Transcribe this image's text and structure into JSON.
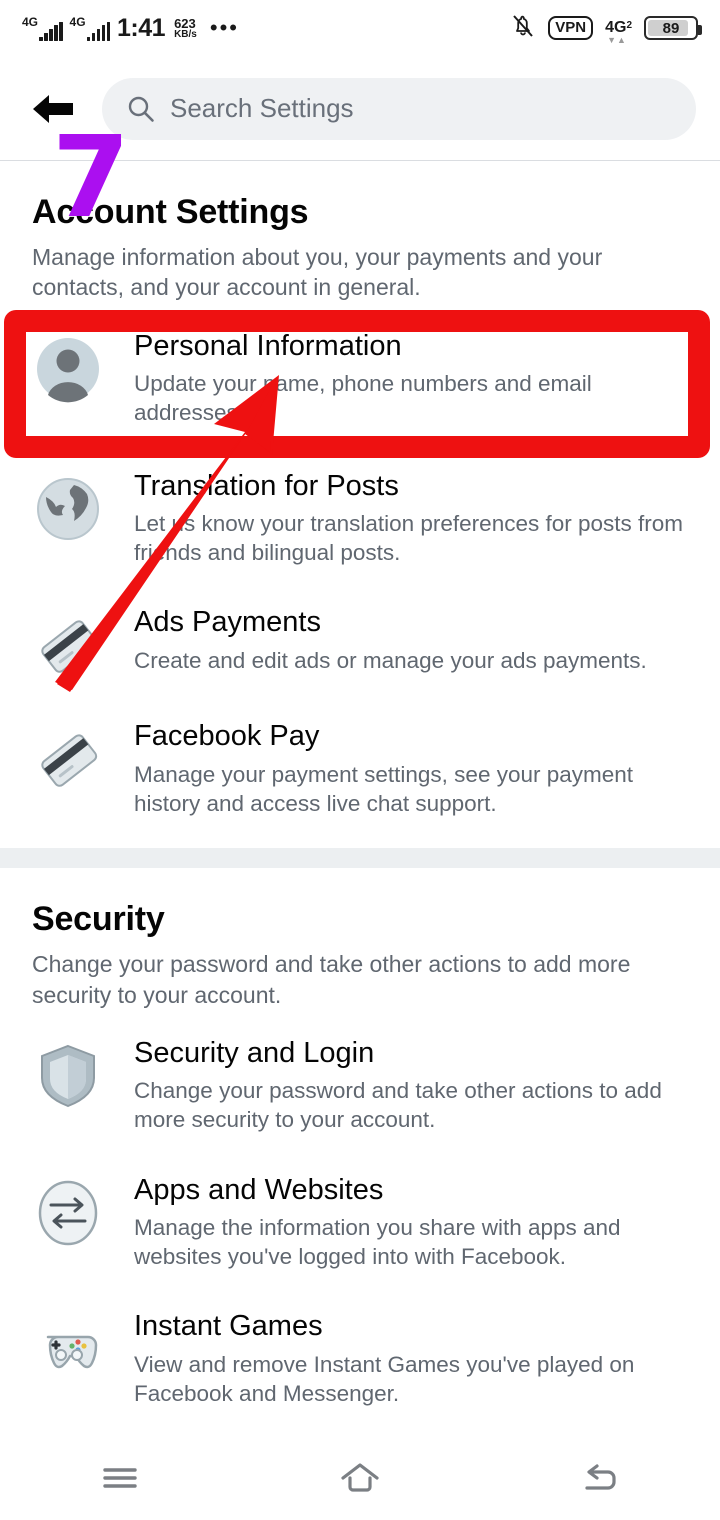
{
  "status_bar": {
    "signal_1_label": "4G",
    "signal_2_label": "4G",
    "time": "1:41",
    "data_speed_value": "623",
    "data_speed_unit": "KB/s",
    "overflow_dots": "•••",
    "mute_icon": "bell-muted-icon",
    "vpn_label": "VPN",
    "network_label": "4G",
    "network_sub": "2",
    "battery_percent": "89"
  },
  "header": {
    "back_icon": "arrow-left-icon",
    "search_icon": "search-icon",
    "search_placeholder": "Search Settings",
    "search_value": ""
  },
  "sections": [
    {
      "title": "Account Settings",
      "description": "Manage information about you, your payments and your contacts, and your account in general.",
      "items": [
        {
          "icon": "user-avatar-icon",
          "title": "Personal Information",
          "description": "Update your name, phone numbers and email addresses."
        },
        {
          "icon": "globe-icon",
          "title": "Translation for Posts",
          "description": "Let us know your translation preferences for posts from friends and bilingual posts."
        },
        {
          "icon": "credit-card-icon",
          "title": "Ads Payments",
          "description": "Create and edit ads or manage your ads payments."
        },
        {
          "icon": "credit-card-icon",
          "title": "Facebook Pay",
          "description": "Manage your payment settings, see your payment history and access live chat support."
        }
      ]
    },
    {
      "title": "Security",
      "description": "Change your password and take other actions to add more security to your account.",
      "items": [
        {
          "icon": "shield-icon",
          "title": "Security and Login",
          "description": "Change your password and take other actions to add more security to your account."
        },
        {
          "icon": "exchange-arrows-icon",
          "title": "Apps and Websites",
          "description": "Manage the information you share with apps and websites you've logged into with Facebook."
        },
        {
          "icon": "gamepad-icon",
          "title": "Instant Games",
          "description": "View and remove Instant Games you've played on Facebook and Messenger."
        }
      ]
    }
  ],
  "navbar": {
    "menu_icon": "hamburger-menu-icon",
    "home_icon": "home-icon",
    "back_icon": "back-arrow-icon"
  },
  "annotations": {
    "step_number": "7",
    "step_number_color": "#ab0ff0",
    "highlight_color": "#ee1111",
    "arrow_color": "#ee1111",
    "highlight_target": "Personal Information"
  }
}
